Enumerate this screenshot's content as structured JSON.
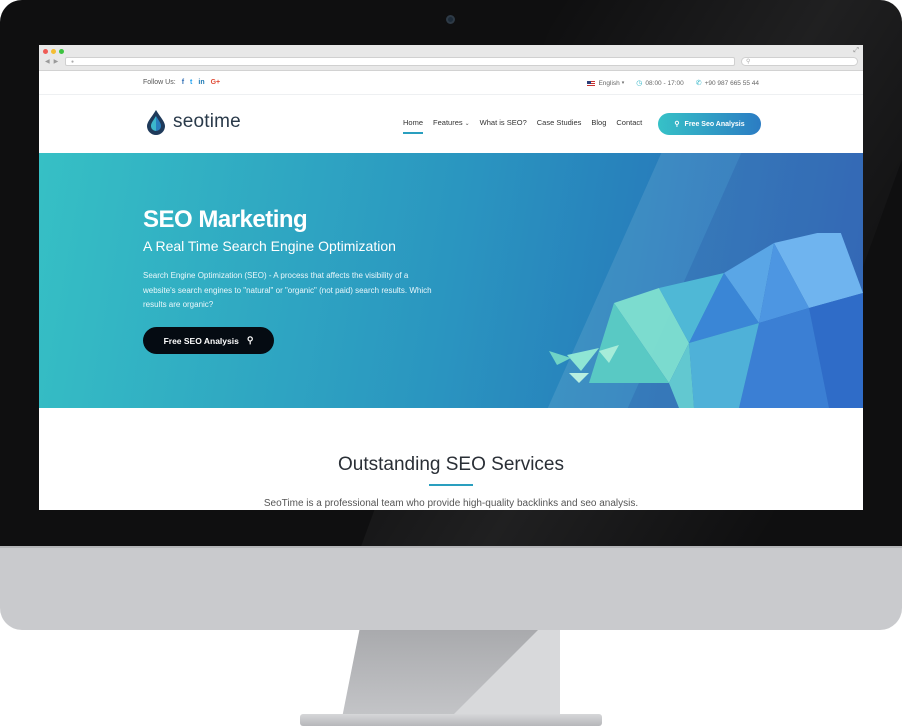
{
  "topbar": {
    "follow_label": "Follow Us:",
    "social": [
      "f",
      "t",
      "in",
      "G+"
    ],
    "language": "English",
    "hours": "08:00 - 17:00",
    "phone": "+90 987 665 55 44"
  },
  "header": {
    "logo_text": "seotime",
    "nav": [
      "Home",
      "Features",
      "What is SEO?",
      "Case Studies",
      "Blog",
      "Contact"
    ],
    "active_nav": "Home",
    "cta_label": "Free Seo Analysis"
  },
  "hero": {
    "title": "SEO Marketing",
    "subtitle": "A Real Time Search Engine Optimization",
    "text": "Search Engine Optimization (SEO) - A process that affects the visibility of a website's search engines to \"natural\" or \"organic\" (not paid) search results. Which results are organic?",
    "button_label": "Free SEO Analysis"
  },
  "services": {
    "title": "Outstanding SEO Services",
    "description": "SeoTime is a professional team who provide high-quality backlinks and seo analysis."
  },
  "colors": {
    "accent": "#2a9fbf",
    "hero_start": "#36c0c5",
    "hero_end": "#2460b5",
    "dark_button": "#050b12"
  },
  "icons": [
    "facebook-icon",
    "twitter-icon",
    "linkedin-icon",
    "google-plus-icon",
    "flag-icon",
    "clock-icon",
    "phone-icon",
    "search-icon",
    "chevron-down-icon",
    "water-drop-logo-icon"
  ]
}
